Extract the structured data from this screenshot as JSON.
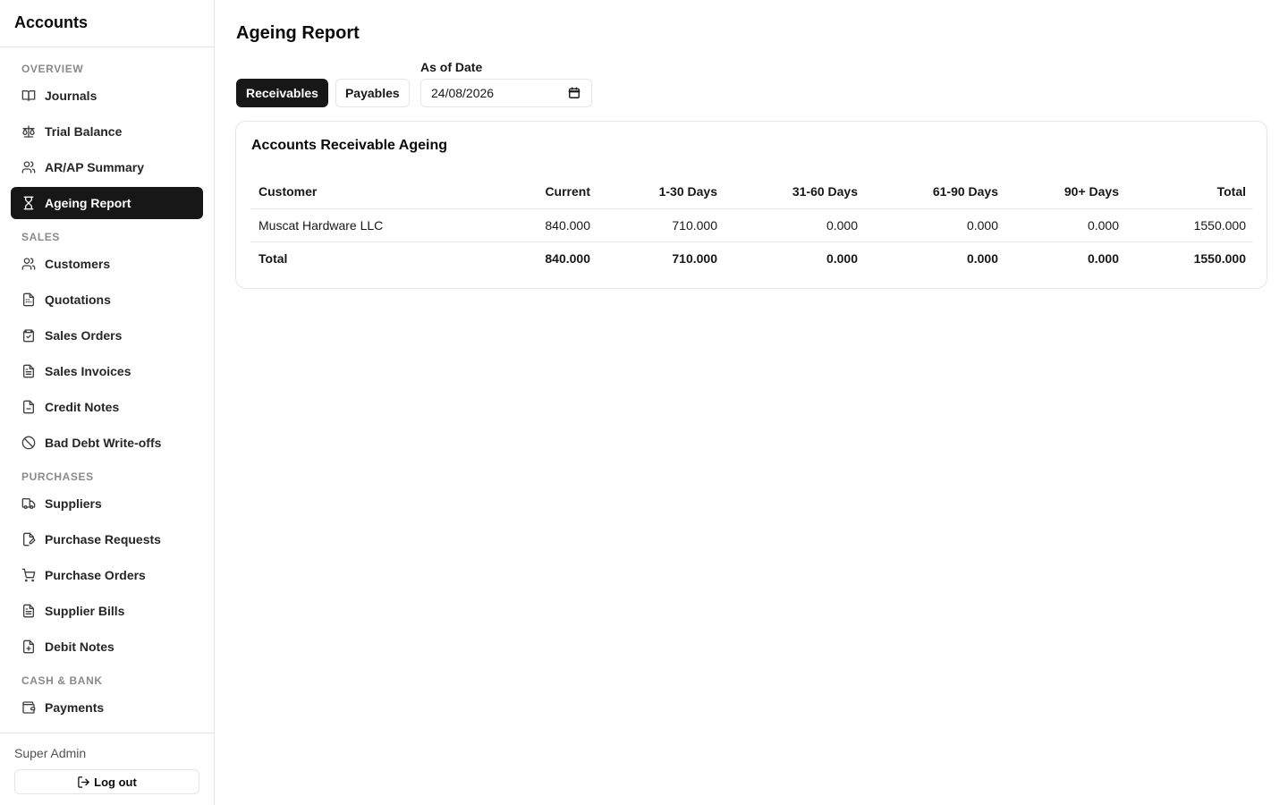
{
  "sidebar": {
    "brand": "Accounts",
    "sections": [
      {
        "label": "OVERVIEW",
        "items": [
          {
            "label": "Journals",
            "icon": "book-icon",
            "active": false
          },
          {
            "label": "Trial Balance",
            "icon": "scale-icon",
            "active": false
          },
          {
            "label": "AR/AP Summary",
            "icon": "users-icon",
            "active": false
          },
          {
            "label": "Ageing Report",
            "icon": "hourglass-icon",
            "active": true
          }
        ]
      },
      {
        "label": "SALES",
        "items": [
          {
            "label": "Customers",
            "icon": "users-icon",
            "active": false
          },
          {
            "label": "Quotations",
            "icon": "calculator-file-icon",
            "active": false
          },
          {
            "label": "Sales Orders",
            "icon": "clipboard-check-icon",
            "active": false
          },
          {
            "label": "Sales Invoices",
            "icon": "file-text-icon",
            "active": false
          },
          {
            "label": "Credit Notes",
            "icon": "file-minus-icon",
            "active": false
          },
          {
            "label": "Bad Debt Write-offs",
            "icon": "ban-icon",
            "active": false
          }
        ]
      },
      {
        "label": "PURCHASES",
        "items": [
          {
            "label": "Suppliers",
            "icon": "truck-icon",
            "active": false
          },
          {
            "label": "Purchase Requests",
            "icon": "file-pen-icon",
            "active": false
          },
          {
            "label": "Purchase Orders",
            "icon": "cart-icon",
            "active": false
          },
          {
            "label": "Supplier Bills",
            "icon": "file-text-icon",
            "active": false
          },
          {
            "label": "Debit Notes",
            "icon": "file-plus-icon",
            "active": false
          }
        ]
      },
      {
        "label": "CASH & BANK",
        "items": [
          {
            "label": "Payments",
            "icon": "wallet-icon",
            "active": false
          }
        ]
      }
    ],
    "user_name": "Super Admin",
    "logout_label": "Log out"
  },
  "main": {
    "title": "Ageing Report",
    "tabs": [
      {
        "label": "Receivables",
        "active": true
      },
      {
        "label": "Payables",
        "active": false
      }
    ],
    "date_label": "As of Date",
    "date_value": "24/08/2026",
    "card_title": "Accounts Receivable Ageing",
    "table": {
      "headers": [
        "Customer",
        "Current",
        "1-30 Days",
        "31-60 Days",
        "61-90 Days",
        "90+ Days",
        "Total"
      ],
      "rows": [
        [
          "Muscat Hardware LLC",
          "840.000",
          "710.000",
          "0.000",
          "0.000",
          "0.000",
          "1550.000"
        ]
      ],
      "total_row": [
        "Total",
        "840.000",
        "710.000",
        "0.000",
        "0.000",
        "0.000",
        "1550.000"
      ]
    }
  },
  "colors": {
    "active_bg": "#171717",
    "border": "#e5e5e5",
    "section_label": "#8a8a8a"
  }
}
